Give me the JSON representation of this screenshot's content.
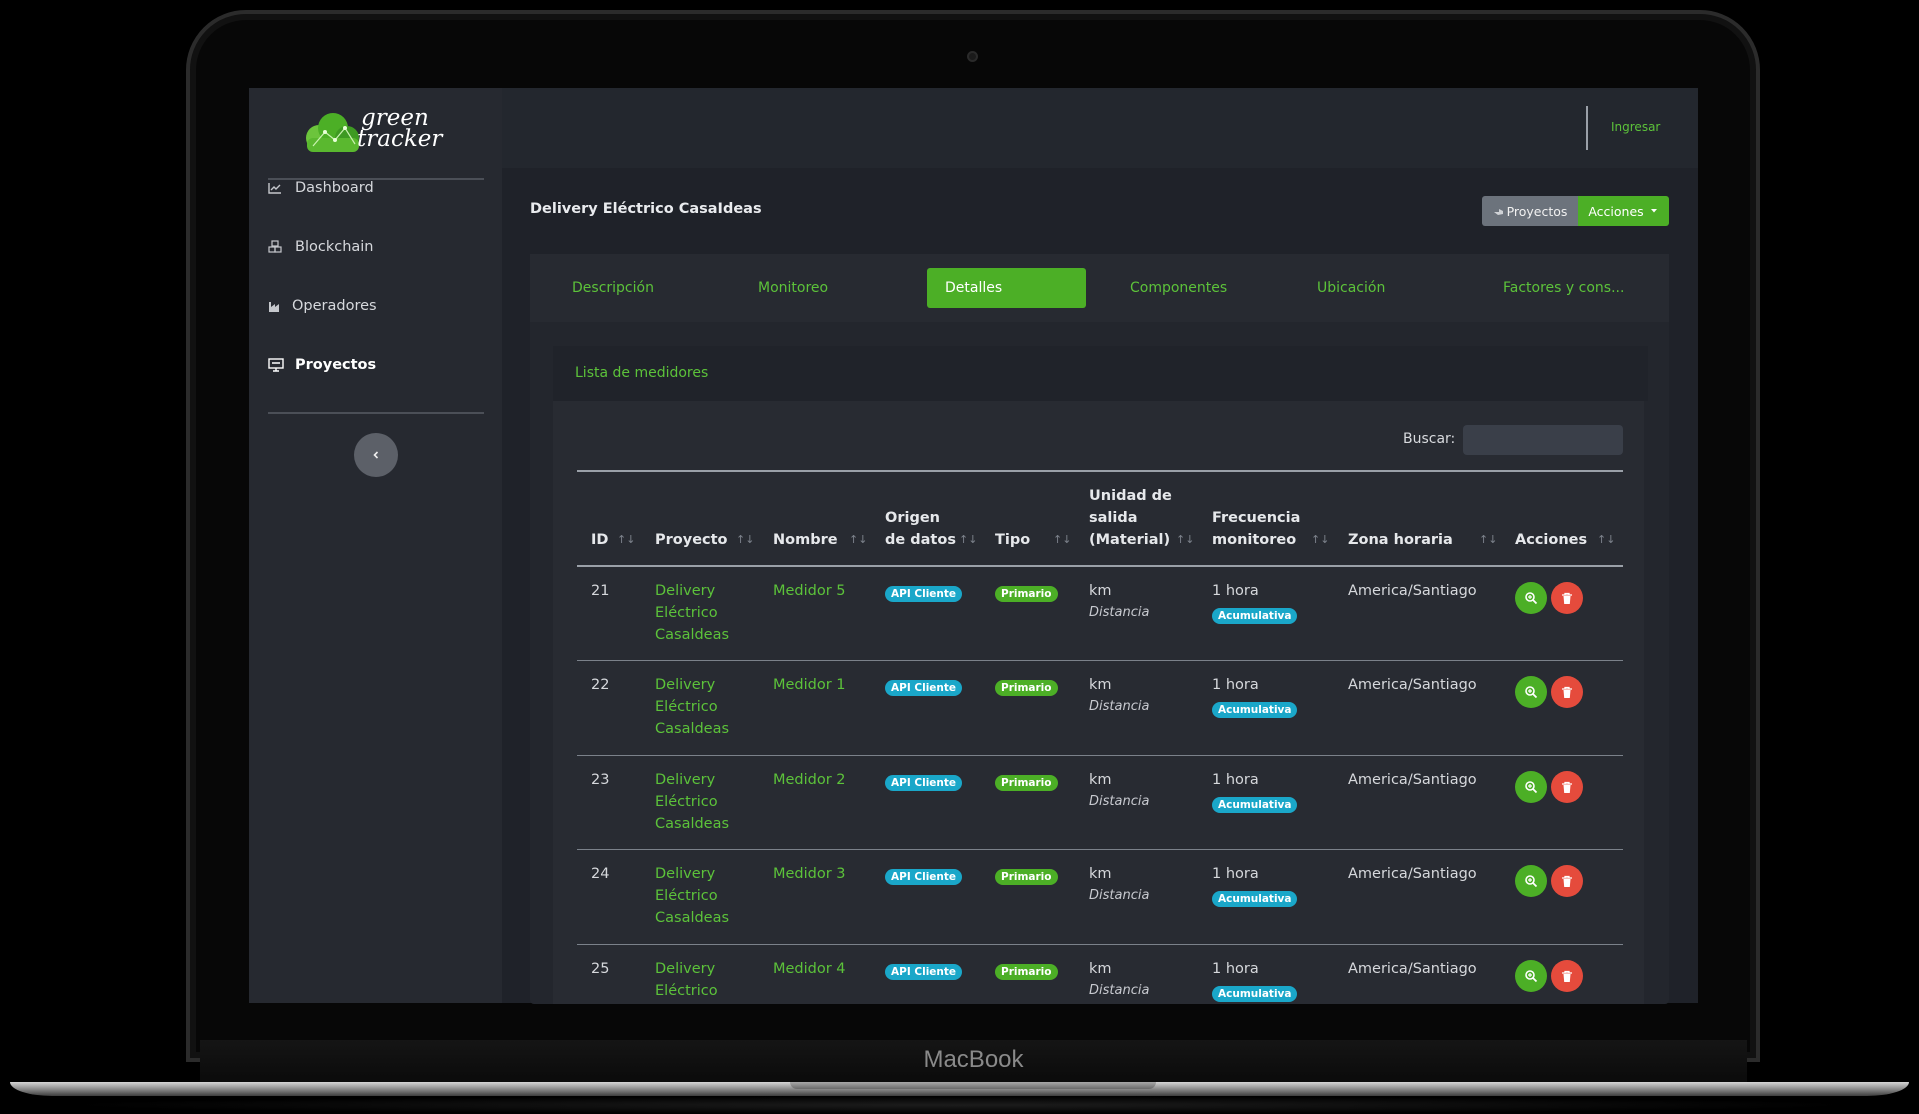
{
  "device": {
    "brand": "MacBook"
  },
  "app": {
    "logo_text_line1": "green",
    "logo_text_line2": "tracker",
    "login_label": "Ingresar",
    "accent_color": "#4caf26"
  },
  "sidebar": {
    "items": [
      {
        "label": "Dashboard",
        "icon": "chart-line-icon",
        "active": false
      },
      {
        "label": "Blockchain",
        "icon": "cubes-icon",
        "active": false
      },
      {
        "label": "Operadores",
        "icon": "industry-icon",
        "active": false
      },
      {
        "label": "Proyectos",
        "icon": "project-diagram-icon",
        "active": true
      }
    ],
    "collapse_icon": "chevron-left-icon"
  },
  "header": {
    "title": "Delivery Eléctrico CasaIdeas",
    "btn_proyectos": "Proyectos",
    "btn_acciones": "Acciones"
  },
  "tabs": [
    {
      "label": "Descripción"
    },
    {
      "label": "Monitoreo"
    },
    {
      "label": "Detalles",
      "active": true
    },
    {
      "label": "Componentes"
    },
    {
      "label": "Ubicación"
    },
    {
      "label": "Factores y cons..."
    }
  ],
  "meters": {
    "title": "Lista de medidores",
    "search_label": "Buscar:",
    "columns": [
      "ID",
      "Proyecto",
      "Nombre",
      "Origen de datos",
      "Tipo",
      "Unidad de salida (Material)",
      "Frecuencia monitoreo",
      "Zona horaria",
      "Acciones"
    ],
    "column_lines": {
      "origen": [
        "Origen",
        "de datos"
      ],
      "unidad": [
        "Unidad de",
        "salida",
        "(Material)"
      ],
      "frecuencia": [
        "Frecuencia",
        "monitoreo"
      ]
    },
    "rows": [
      {
        "id": "21",
        "proyecto": [
          "Delivery",
          "Eléctrico",
          "Casaldeas"
        ],
        "nombre": "Medidor 5",
        "origen": "API Cliente",
        "tipo": "Primario",
        "unidad": "km",
        "material": "Distancia",
        "frecuencia": "1 hora",
        "freq_badge": "Acumulativa",
        "zona": "America/Santiago"
      },
      {
        "id": "22",
        "proyecto": [
          "Delivery",
          "Eléctrico",
          "Casaldeas"
        ],
        "nombre": "Medidor 1",
        "origen": "API Cliente",
        "tipo": "Primario",
        "unidad": "km",
        "material": "Distancia",
        "frecuencia": "1 hora",
        "freq_badge": "Acumulativa",
        "zona": "America/Santiago"
      },
      {
        "id": "23",
        "proyecto": [
          "Delivery",
          "Eléctrico",
          "Casaldeas"
        ],
        "nombre": "Medidor 2",
        "origen": "API Cliente",
        "tipo": "Primario",
        "unidad": "km",
        "material": "Distancia",
        "frecuencia": "1 hora",
        "freq_badge": "Acumulativa",
        "zona": "America/Santiago"
      },
      {
        "id": "24",
        "proyecto": [
          "Delivery",
          "Eléctrico",
          "Casaldeas"
        ],
        "nombre": "Medidor 3",
        "origen": "API Cliente",
        "tipo": "Primario",
        "unidad": "km",
        "material": "Distancia",
        "frecuencia": "1 hora",
        "freq_badge": "Acumulativa",
        "zona": "America/Santiago"
      },
      {
        "id": "25",
        "proyecto": [
          "Delivery",
          "Eléctrico"
        ],
        "nombre": "Medidor 4",
        "origen": "API Cliente",
        "tipo": "Primario",
        "unidad": "km",
        "material": "Distancia",
        "frecuencia": "1 hora",
        "freq_badge": "Acumulativa",
        "zona": "America/Santiago"
      }
    ]
  }
}
